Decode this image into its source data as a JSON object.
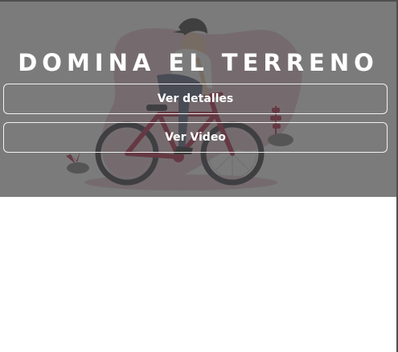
{
  "hero": {
    "title": "DOMINA EL TERRENO",
    "illustration": "cyclist-on-red-bicycle",
    "overlay_color": "#484848"
  },
  "buttons": {
    "details_label": "Ver detalles",
    "video_label": "Ver Video"
  },
  "colors": {
    "bike": "#b0143c",
    "blob": "#e9c6cf",
    "text": "#ffffff"
  }
}
